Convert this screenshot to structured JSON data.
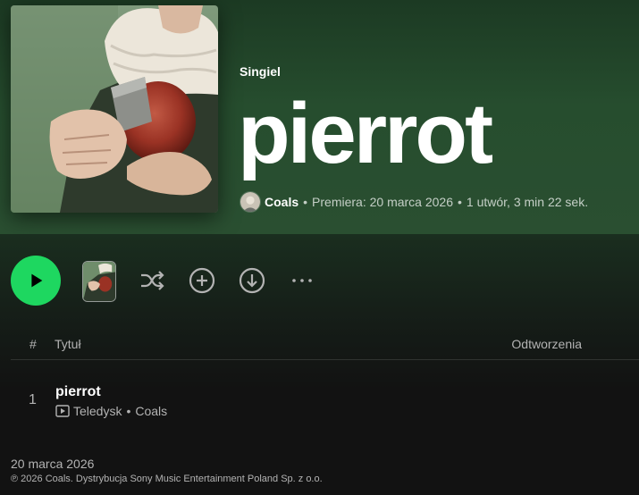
{
  "album": {
    "type_label": "Singiel",
    "title": "pierrot",
    "artist": "Coals",
    "release_info": "Premiera: 20 marca 2026",
    "summary": "1 utwór, 3 min 22 sek.",
    "separator": "•"
  },
  "actions": {
    "play_icon": "play-icon",
    "shuffle_icon": "shuffle-icon",
    "add_icon": "add-circle-icon",
    "download_icon": "download-icon",
    "more_label": "···",
    "accent_color": "#1ed760"
  },
  "tracklist": {
    "headers": {
      "number": "#",
      "title": "Tytuł",
      "plays": "Odtworzenia"
    },
    "tracks": [
      {
        "number": "1",
        "title": "pierrot",
        "type": "Teledysk",
        "artist": "Coals"
      }
    ]
  },
  "footer": {
    "release_date": "20 marca 2026",
    "copyright": "℗ 2026 Coals. Dystrybucja Sony Music Entertainment Poland Sp. z o.o."
  }
}
